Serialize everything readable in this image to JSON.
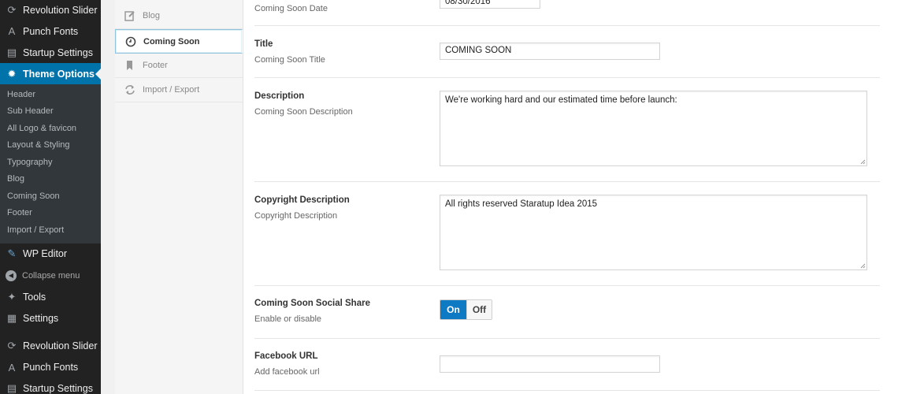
{
  "admin_menu": {
    "top_items": [
      {
        "label": "Revolution Slider",
        "icon": "refresh-icon"
      },
      {
        "label": "Punch Fonts",
        "icon": "font-icon"
      },
      {
        "label": "Startup Settings",
        "icon": "list-icon"
      }
    ],
    "current": {
      "label": "Theme Options",
      "icon": "gear-icon"
    },
    "submenu": [
      "Header",
      "Sub Header",
      "All Logo & favicon",
      "Layout & Styling",
      "Typography",
      "Blog",
      "Coming Soon",
      "Footer",
      "Import / Export"
    ],
    "bottom_items": [
      {
        "label": "WP Editor",
        "icon": "pencil-icon"
      },
      {
        "label": "Collapse menu",
        "icon": "collapse-icon"
      },
      {
        "label": "Tools",
        "icon": "wrench-icon"
      },
      {
        "label": "Settings",
        "icon": "settings-icon"
      },
      {
        "label": "Revolution Slider",
        "icon": "refresh-icon"
      },
      {
        "label": "Punch Fonts",
        "icon": "font-icon"
      },
      {
        "label": "Startup Settings",
        "icon": "list-icon"
      }
    ]
  },
  "option_tabs": [
    {
      "label": "Blog",
      "icon": "edit-icon",
      "active": false
    },
    {
      "label": "Coming Soon",
      "icon": "clock-icon",
      "active": true
    },
    {
      "label": "Footer",
      "icon": "bookmark-icon",
      "active": false
    },
    {
      "label": "Import / Export",
      "icon": "sync-icon",
      "active": false
    }
  ],
  "fields": {
    "date": {
      "description": "Coming Soon Date",
      "value": "08/30/2016"
    },
    "title": {
      "label": "Title",
      "description": "Coming Soon Title",
      "value": "COMING SOON"
    },
    "description": {
      "label": "Description",
      "description": "Coming Soon Description",
      "value": "We're working hard and our estimated time before launch:"
    },
    "copyright": {
      "label": "Copyright Description",
      "description": "Copyright Description",
      "value": "All rights reserved Staratup Idea 2015"
    },
    "social_share": {
      "label": "Coming Soon Social Share",
      "description": "Enable or disable",
      "on_label": "On",
      "off_label": "Off",
      "enabled": true
    },
    "facebook": {
      "label": "Facebook URL",
      "description": "Add facebook url",
      "value": ""
    }
  },
  "colors": {
    "accent": "#0073aa",
    "toggle_on": "#0e7ac4",
    "sidebar": "#222222"
  }
}
